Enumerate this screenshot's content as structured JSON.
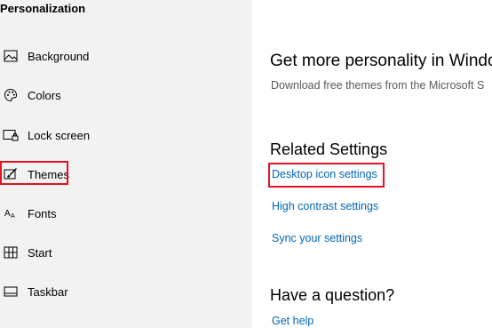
{
  "sidebar": {
    "title": "Personalization",
    "items": [
      {
        "label": "Background",
        "icon": "image-icon"
      },
      {
        "label": "Colors",
        "icon": "palette-icon"
      },
      {
        "label": "Lock screen",
        "icon": "lock-screen-icon"
      },
      {
        "label": "Themes",
        "icon": "brush-icon"
      },
      {
        "label": "Fonts",
        "icon": "font-icon"
      },
      {
        "label": "Start",
        "icon": "start-icon"
      },
      {
        "label": "Taskbar",
        "icon": "taskbar-icon"
      }
    ]
  },
  "main": {
    "personality_heading": "Get more personality in Windo",
    "personality_desc": "Download free themes from the Microsoft S",
    "related_heading": "Related Settings",
    "related_links": [
      "Desktop icon settings",
      "High contrast settings",
      "Sync your settings"
    ],
    "question_heading": "Have a question?",
    "help_link": "Get help"
  },
  "colors": {
    "highlight": "#e81123",
    "link": "#0067b8",
    "sidebar_bg": "#f2f2f2"
  }
}
